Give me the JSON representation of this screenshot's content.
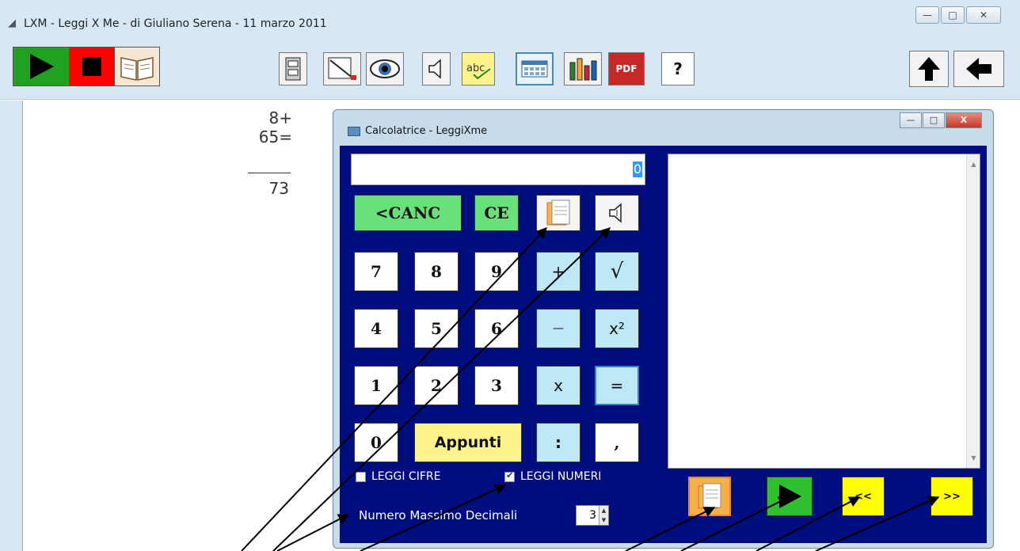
{
  "window": {
    "title": "LXM - Leggi X Me - di Giuliano Serena - 11 marzo 2011",
    "controls": {
      "minimize": "—",
      "maximize": "□",
      "close": "✕"
    }
  },
  "toolbar": {
    "help_label": "?",
    "pdf_label": "PDF"
  },
  "work_area": {
    "lines": [
      "8+",
      "65=",
      "73"
    ]
  },
  "calculator": {
    "title": "Calcolatrice -  LeggiXme",
    "controls": {
      "minimize": "—",
      "maximize": "□",
      "close": "X"
    },
    "display_value": "0",
    "keys": {
      "canc": "<CANC",
      "ce": "CE",
      "k7": "7",
      "k8": "8",
      "k9": "9",
      "plus": "+",
      "sqrt": "√",
      "k4": "4",
      "k5": "5",
      "k6": "6",
      "minus": "—",
      "square": "x²",
      "k1": "1",
      "k2": "2",
      "k3": "3",
      "times": "x",
      "equals": "=",
      "k0": "0",
      "appunti": "Appunti",
      "colon": ":",
      "comma": ","
    },
    "checkboxes": {
      "leggi_cifre": {
        "label": "LEGGI CIFRE",
        "checked": false
      },
      "leggi_numeri": {
        "label": "LEGGI NUMERI",
        "checked": true
      }
    },
    "decimals": {
      "label": "Numero Massimo Decimali",
      "value": "3"
    },
    "bottom_buttons": {
      "prev": "<<",
      "next": ">>"
    }
  },
  "colors": {
    "calc_body": "#000d7e",
    "key_green": "#6ae07a",
    "key_blue": "#bfe8f6",
    "key_yellow": "#fdf58c",
    "nav_yellow": "#ffff00"
  }
}
